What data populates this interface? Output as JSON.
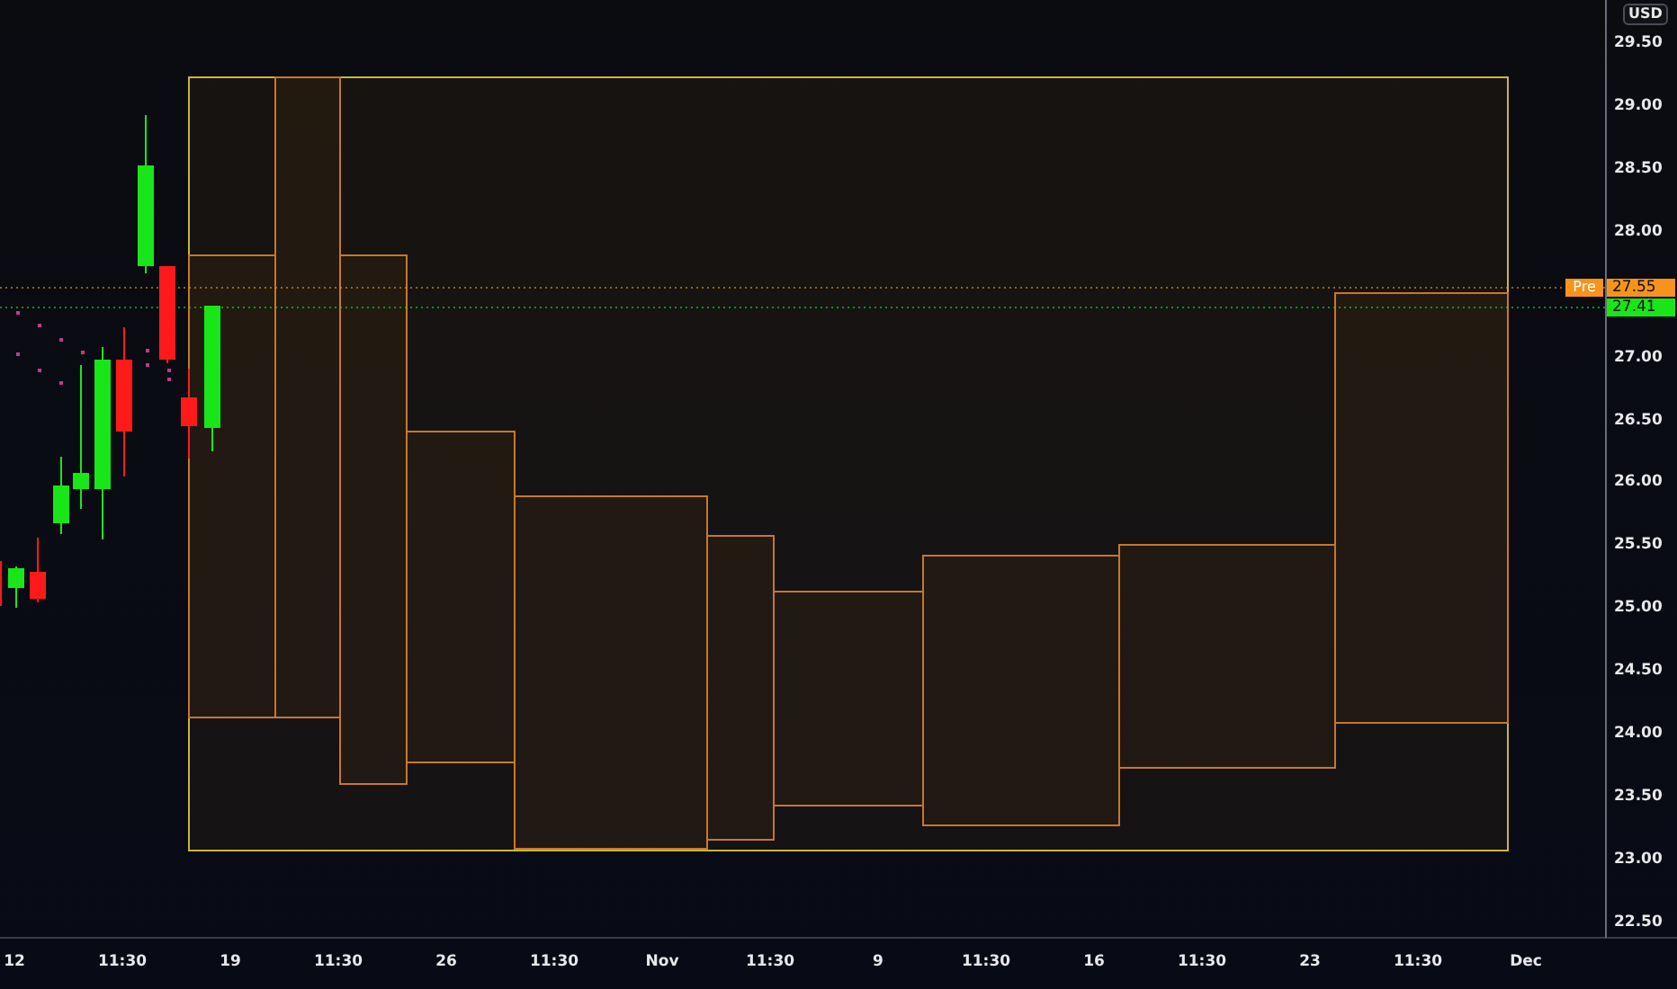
{
  "price_axis": {
    "currency": "USD",
    "labels": [
      "29.50",
      "29.00",
      "28.50",
      "28.00",
      "27.00",
      "26.50",
      "26.00",
      "25.50",
      "25.00",
      "24.50",
      "24.00",
      "23.50",
      "23.00",
      "22.50"
    ]
  },
  "price_tags": [
    {
      "kind": "premarket",
      "label": "Pre",
      "value": "27.55"
    },
    {
      "kind": "last",
      "value": "27.41"
    }
  ],
  "time_axis": {
    "labels": [
      "12",
      "11:30",
      "19",
      "11:30",
      "26",
      "11:30",
      "Nov",
      "11:30",
      "9",
      "11:30",
      "16",
      "11:30",
      "23",
      "11:30",
      "Dec"
    ]
  }
}
